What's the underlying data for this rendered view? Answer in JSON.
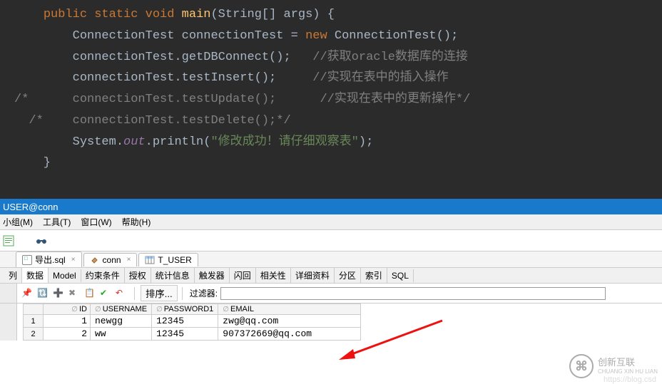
{
  "code": {
    "l1_kw1": "public",
    "l1_kw2": "static",
    "l1_kw3": "void",
    "l1_fn": "main",
    "l1_sig": "(String[] args) {",
    "l2_a": "        ConnectionTest connectionTest = ",
    "l2_kw": "new",
    "l2_b": " ConnectionTest();",
    "l3_a": "        connectionTest.getDBConnect();   ",
    "l3_c": "//获取oracle数据库的连接",
    "l4_a": "        connectionTest.testInsert();     ",
    "l4_c": "//实现在表中的插入操作",
    "l5_c": "/*      connectionTest.testUpdate();      //实现在表中的更新操作*/",
    "l6_c": "  /*    connectionTest.testDelete();*/",
    "l7_a": "        System.",
    "l7_field": "out",
    "l7_b": ".println(",
    "l7_str": "\"修改成功！请仔细观察表\"",
    "l7_c": ");",
    "l8": "    }"
  },
  "title_bar": "USER@conn",
  "menu": {
    "group": "小组(M)",
    "tools": "工具(T)",
    "window": "窗口(W)",
    "help": "帮助(H)"
  },
  "tabs": {
    "sql_export": "导出.sql",
    "conn": "conn",
    "tuser": "T_USER"
  },
  "sub_tabs": [
    "列",
    "数据",
    "Model",
    "约束条件",
    "授权",
    "统计信息",
    "触发器",
    "闪回",
    "相关性",
    "详细资料",
    "分区",
    "索引",
    "SQL"
  ],
  "action_bar": {
    "sort": "排序...",
    "filter_label": "过滤器:"
  },
  "table": {
    "headers": {
      "id": "ID",
      "username": "USERNAME",
      "password": "PASSWORD1",
      "email": "EMAIL"
    },
    "rows": [
      {
        "n": "1",
        "id": "1",
        "username": "newgg",
        "password": "12345",
        "email": "zwg@qq.com"
      },
      {
        "n": "2",
        "id": "2",
        "username": "ww",
        "password": "12345",
        "email": "907372669@qq.com"
      }
    ]
  },
  "watermark": {
    "main": "创新互联",
    "sub": "CHUANG XIN HU LIAN",
    "url": "https://blog.csd"
  }
}
